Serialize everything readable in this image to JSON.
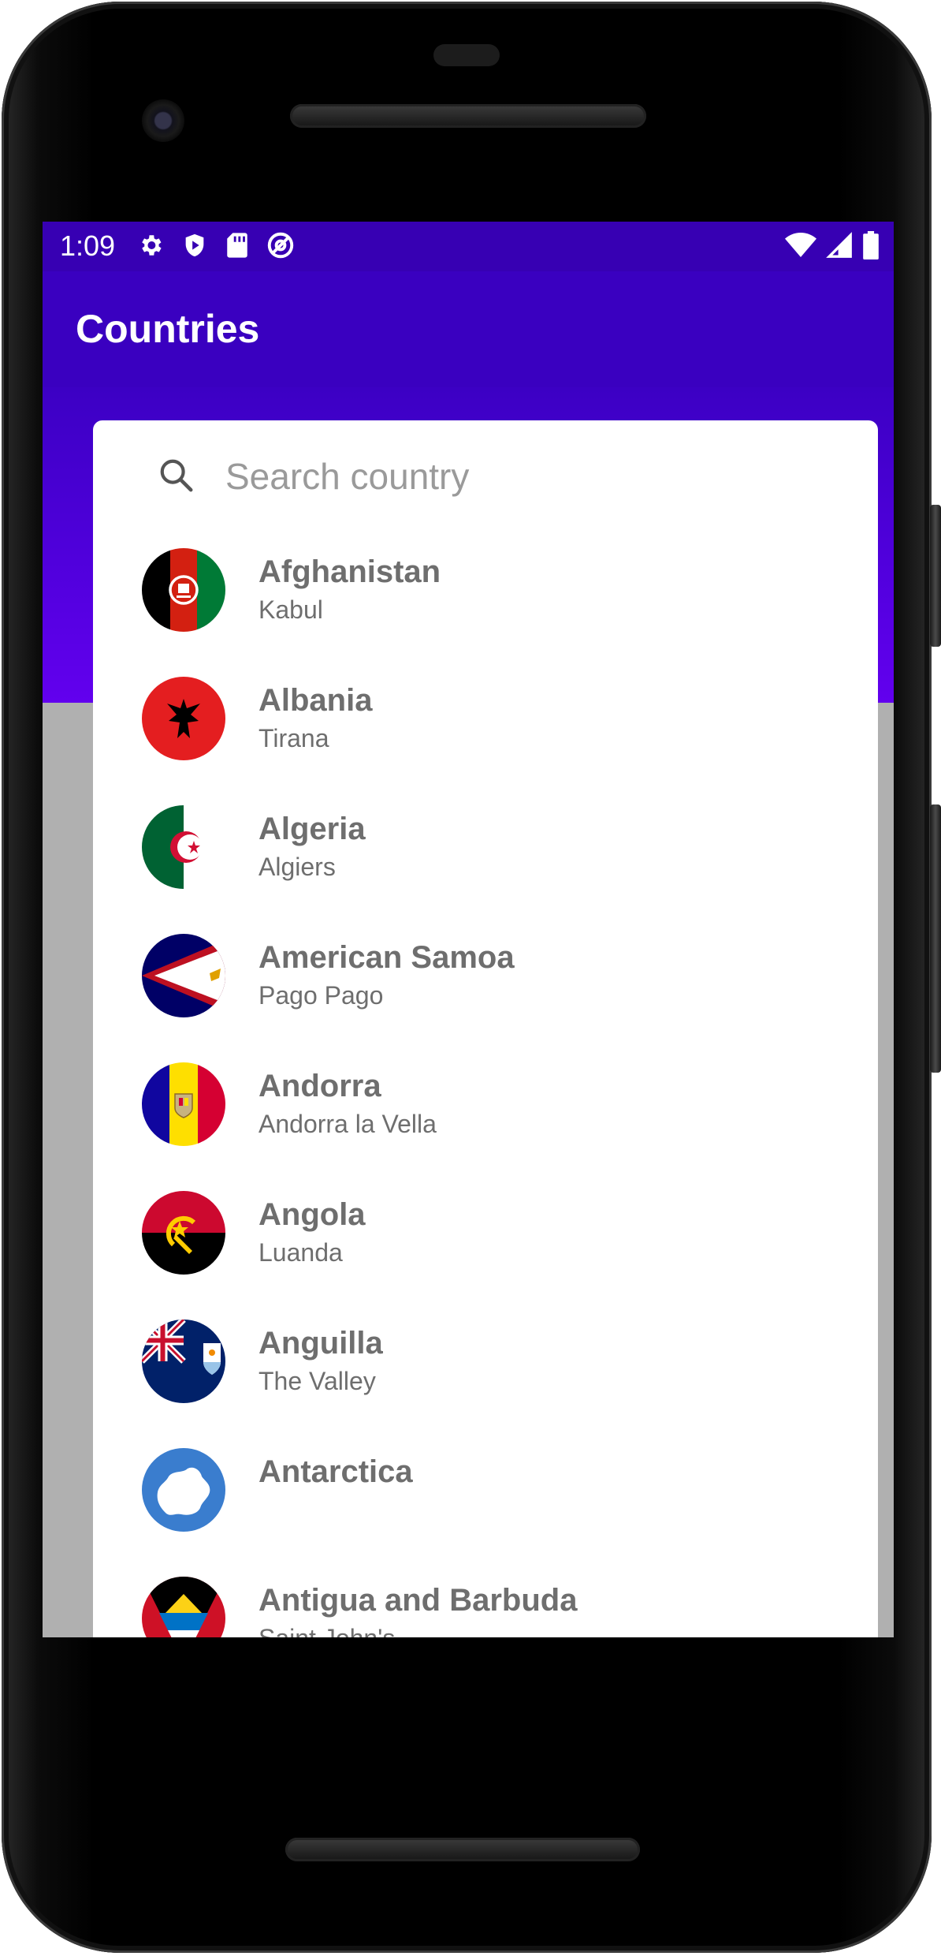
{
  "status_bar": {
    "time": "1:09",
    "left_icons": [
      "settings-gear-icon",
      "shield-play-icon",
      "sd-card-icon",
      "at-sign-icon"
    ],
    "right_icons": [
      "wifi-icon",
      "signal-icon",
      "battery-icon"
    ]
  },
  "app_bar": {
    "title": "Countries"
  },
  "search": {
    "placeholder": "Search country",
    "value": ""
  },
  "countries": [
    {
      "name": "Afghanistan",
      "capital": "Kabul",
      "flag": "afghanistan-flag-icon"
    },
    {
      "name": "Albania",
      "capital": "Tirana",
      "flag": "albania-flag-icon"
    },
    {
      "name": "Algeria",
      "capital": "Algiers",
      "flag": "algeria-flag-icon"
    },
    {
      "name": "American Samoa",
      "capital": "Pago Pago",
      "flag": "american-samoa-flag-icon"
    },
    {
      "name": "Andorra",
      "capital": "Andorra la Vella",
      "flag": "andorra-flag-icon"
    },
    {
      "name": "Angola",
      "capital": "Luanda",
      "flag": "angola-flag-icon"
    },
    {
      "name": "Anguilla",
      "capital": "The Valley",
      "flag": "anguilla-flag-icon"
    },
    {
      "name": "Antarctica",
      "capital": "",
      "flag": "antarctica-flag-icon"
    },
    {
      "name": "Antigua and Barbuda",
      "capital": "Saint John's",
      "flag": "antigua-and-barbuda-flag-icon"
    }
  ],
  "colors": {
    "primary_dark": "#3700b3",
    "primary": "#6200ee",
    "text_secondary": "#6e6e6e",
    "placeholder": "#9a9a9a"
  },
  "nav_bar": {
    "buttons": [
      "back-icon",
      "home-icon",
      "recent-apps-icon"
    ]
  }
}
